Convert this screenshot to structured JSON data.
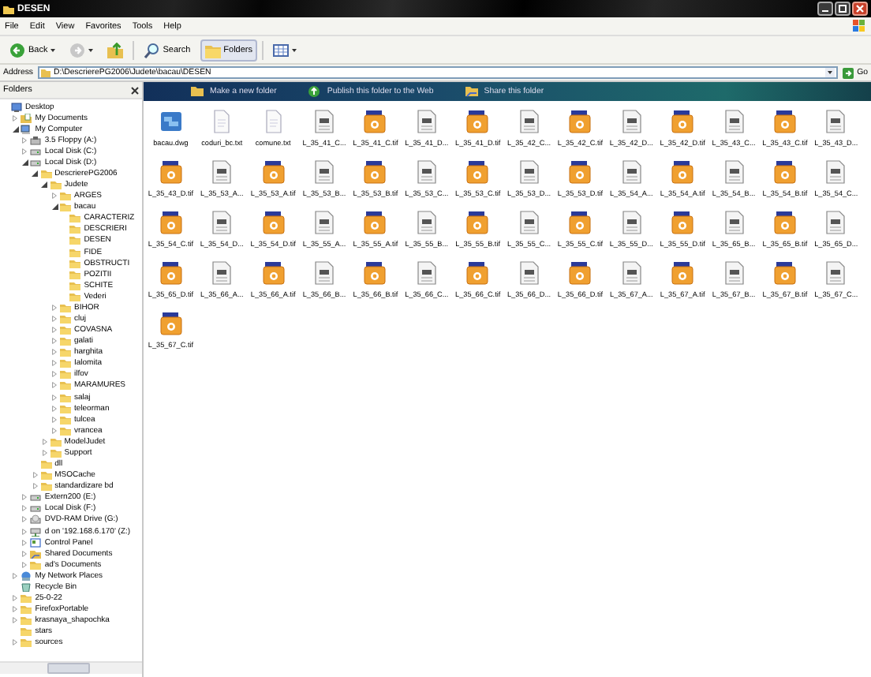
{
  "window": {
    "title": "DESEN"
  },
  "menu": [
    "File",
    "Edit",
    "View",
    "Favorites",
    "Tools",
    "Help"
  ],
  "toolbar": [
    {
      "kind": "back",
      "label": "Back",
      "pressed": false
    },
    {
      "kind": "forward",
      "pressed": false
    },
    {
      "kind": "up",
      "pressed": false
    },
    {
      "kind": "search",
      "label": "Search",
      "pressed": false
    },
    {
      "kind": "folders",
      "label": "Folders",
      "pressed": true
    },
    {
      "kind": "views",
      "pressed": false
    }
  ],
  "address": {
    "label": "Address",
    "value": "D:\\DescrierePG2006\\Judete\\bacau\\DESEN",
    "go": "Go"
  },
  "folders_pane": {
    "title": "Folders",
    "tree": [
      {
        "label": "Desktop",
        "kind": "desktop",
        "children": [
          {
            "label": "My Documents",
            "kind": "documents",
            "expanded": false
          },
          {
            "label": "My Computer",
            "kind": "computer",
            "expanded": true,
            "children": [
              {
                "label": "3.5 Floppy (A:)",
                "kind": "floppy",
                "expanded": false
              },
              {
                "label": "Local Disk (C:)",
                "kind": "drive",
                "expanded": false
              },
              {
                "label": "Local Disk (D:)",
                "kind": "drive",
                "expanded": true,
                "children": [
                  {
                    "label": "DescrierePG2006",
                    "kind": "folder",
                    "expanded": true,
                    "children": [
                      {
                        "label": "Judete",
                        "kind": "folder",
                        "expanded": true,
                        "children": [
                          {
                            "label": "ARGES",
                            "kind": "folder",
                            "expanded": false
                          },
                          {
                            "label": "bacau",
                            "kind": "folder",
                            "expanded": true,
                            "children": [
                              {
                                "label": "CARACTERIZ",
                                "kind": "folder"
                              },
                              {
                                "label": "DESCRIERI",
                                "kind": "folder"
                              },
                              {
                                "label": "DESEN",
                                "kind": "folder"
                              },
                              {
                                "label": "FIDE",
                                "kind": "folder"
                              },
                              {
                                "label": "OBSTRUCTI",
                                "kind": "folder"
                              },
                              {
                                "label": "POZITII",
                                "kind": "folder"
                              },
                              {
                                "label": "SCHITE",
                                "kind": "folder"
                              },
                              {
                                "label": "Vederi",
                                "kind": "folder"
                              }
                            ]
                          },
                          {
                            "label": "BIHOR",
                            "kind": "folder",
                            "expanded": false
                          },
                          {
                            "label": "cluj",
                            "kind": "folder",
                            "expanded": false
                          },
                          {
                            "label": "COVASNA",
                            "kind": "folder",
                            "expanded": false
                          },
                          {
                            "label": "galati",
                            "kind": "folder",
                            "expanded": false
                          },
                          {
                            "label": "harghita",
                            "kind": "folder",
                            "expanded": false
                          },
                          {
                            "label": "Ialomita",
                            "kind": "folder",
                            "expanded": false
                          },
                          {
                            "label": "ilfov",
                            "kind": "folder",
                            "expanded": false
                          },
                          {
                            "label": "MARAMURES",
                            "kind": "folder",
                            "expanded": false
                          },
                          {
                            "label": "salaj",
                            "kind": "folder",
                            "expanded": false
                          },
                          {
                            "label": "teleorman",
                            "kind": "folder",
                            "expanded": false
                          },
                          {
                            "label": "tulcea",
                            "kind": "folder",
                            "expanded": false
                          },
                          {
                            "label": "vrancea",
                            "kind": "folder",
                            "expanded": false
                          }
                        ]
                      },
                      {
                        "label": "ModelJudet",
                        "kind": "folder",
                        "expanded": false
                      },
                      {
                        "label": "Support",
                        "kind": "folder",
                        "expanded": false
                      }
                    ]
                  },
                  {
                    "label": "dll",
                    "kind": "folder"
                  },
                  {
                    "label": "MSOCache",
                    "kind": "folder",
                    "expanded": false
                  },
                  {
                    "label": "standardizare bd",
                    "kind": "folder",
                    "expanded": false
                  }
                ]
              },
              {
                "label": "Extern200 (E:)",
                "kind": "drive",
                "expanded": false
              },
              {
                "label": "Local Disk (F:)",
                "kind": "drive",
                "expanded": false
              },
              {
                "label": "DVD-RAM Drive (G:)",
                "kind": "dvd",
                "expanded": false
              },
              {
                "label": "d on '192.168.6.170' (Z:)",
                "kind": "netdrive",
                "expanded": false
              },
              {
                "label": "Control Panel",
                "kind": "control",
                "expanded": false
              },
              {
                "label": "Shared Documents",
                "kind": "shared",
                "expanded": false
              },
              {
                "label": "ad's Documents",
                "kind": "folder",
                "expanded": false
              }
            ]
          },
          {
            "label": "My Network Places",
            "kind": "network",
            "expanded": false
          },
          {
            "label": "Recycle Bin",
            "kind": "recycle"
          },
          {
            "label": "25-0-22",
            "kind": "folder",
            "expanded": false
          },
          {
            "label": "FirefoxPortable",
            "kind": "folder",
            "expanded": false
          },
          {
            "label": "krasnaya_shapochka",
            "kind": "folder",
            "expanded": false
          },
          {
            "label": "stars",
            "kind": "folder"
          },
          {
            "label": "sources",
            "kind": "folder",
            "expanded": false
          }
        ]
      }
    ]
  },
  "tasks": [
    "Make a new folder",
    "Publish this folder to the Web",
    "Share this folder"
  ],
  "files": [
    {
      "name": "bacau.dwg",
      "kind": "dwg"
    },
    {
      "name": "coduri_bc.txt",
      "kind": "txt"
    },
    {
      "name": "comune.txt",
      "kind": "txt"
    },
    {
      "name": "L_35_41_C...",
      "kind": "doc"
    },
    {
      "name": "L_35_41_C.tif",
      "kind": "tif"
    },
    {
      "name": "L_35_41_D...",
      "kind": "doc"
    },
    {
      "name": "L_35_41_D.tif",
      "kind": "tif"
    },
    {
      "name": "L_35_42_C...",
      "kind": "doc"
    },
    {
      "name": "L_35_42_C.tif",
      "kind": "tif"
    },
    {
      "name": "L_35_42_D...",
      "kind": "doc"
    },
    {
      "name": "L_35_42_D.tif",
      "kind": "tif"
    },
    {
      "name": "L_35_43_C...",
      "kind": "doc"
    },
    {
      "name": "L_35_43_C.tif",
      "kind": "tif"
    },
    {
      "name": "L_35_43_D...",
      "kind": "doc"
    },
    {
      "name": "L_35_43_D.tif",
      "kind": "tif"
    },
    {
      "name": "L_35_53_A...",
      "kind": "doc"
    },
    {
      "name": "L_35_53_A.tif",
      "kind": "tif"
    },
    {
      "name": "L_35_53_B...",
      "kind": "doc"
    },
    {
      "name": "L_35_53_B.tif",
      "kind": "tif"
    },
    {
      "name": "L_35_53_C...",
      "kind": "doc"
    },
    {
      "name": "L_35_53_C.tif",
      "kind": "tif"
    },
    {
      "name": "L_35_53_D...",
      "kind": "doc"
    },
    {
      "name": "L_35_53_D.tif",
      "kind": "tif"
    },
    {
      "name": "L_35_54_A...",
      "kind": "doc"
    },
    {
      "name": "L_35_54_A.tif",
      "kind": "tif"
    },
    {
      "name": "L_35_54_B...",
      "kind": "doc"
    },
    {
      "name": "L_35_54_B.tif",
      "kind": "tif"
    },
    {
      "name": "L_35_54_C...",
      "kind": "doc"
    },
    {
      "name": "L_35_54_C.tif",
      "kind": "tif"
    },
    {
      "name": "L_35_54_D...",
      "kind": "doc"
    },
    {
      "name": "L_35_54_D.tif",
      "kind": "tif"
    },
    {
      "name": "L_35_55_A...",
      "kind": "doc"
    },
    {
      "name": "L_35_55_A.tif",
      "kind": "tif"
    },
    {
      "name": "L_35_55_B...",
      "kind": "doc"
    },
    {
      "name": "L_35_55_B.tif",
      "kind": "tif"
    },
    {
      "name": "L_35_55_C...",
      "kind": "doc"
    },
    {
      "name": "L_35_55_C.tif",
      "kind": "tif"
    },
    {
      "name": "L_35_55_D...",
      "kind": "doc"
    },
    {
      "name": "L_35_55_D.tif",
      "kind": "tif"
    },
    {
      "name": "L_35_65_B...",
      "kind": "doc"
    },
    {
      "name": "L_35_65_B.tif",
      "kind": "tif"
    },
    {
      "name": "L_35_65_D...",
      "kind": "doc"
    },
    {
      "name": "L_35_65_D.tif",
      "kind": "tif"
    },
    {
      "name": "L_35_66_A...",
      "kind": "doc"
    },
    {
      "name": "L_35_66_A.tif",
      "kind": "tif"
    },
    {
      "name": "L_35_66_B...",
      "kind": "doc"
    },
    {
      "name": "L_35_66_B.tif",
      "kind": "tif"
    },
    {
      "name": "L_35_66_C...",
      "kind": "doc"
    },
    {
      "name": "L_35_66_C.tif",
      "kind": "tif"
    },
    {
      "name": "L_35_66_D...",
      "kind": "doc"
    },
    {
      "name": "L_35_66_D.tif",
      "kind": "tif"
    },
    {
      "name": "L_35_67_A...",
      "kind": "doc"
    },
    {
      "name": "L_35_67_A.tif",
      "kind": "tif"
    },
    {
      "name": "L_35_67_B...",
      "kind": "doc"
    },
    {
      "name": "L_35_67_B.tif",
      "kind": "tif"
    },
    {
      "name": "L_35_67_C...",
      "kind": "doc"
    },
    {
      "name": "L_35_67_C.tif",
      "kind": "tif"
    }
  ]
}
